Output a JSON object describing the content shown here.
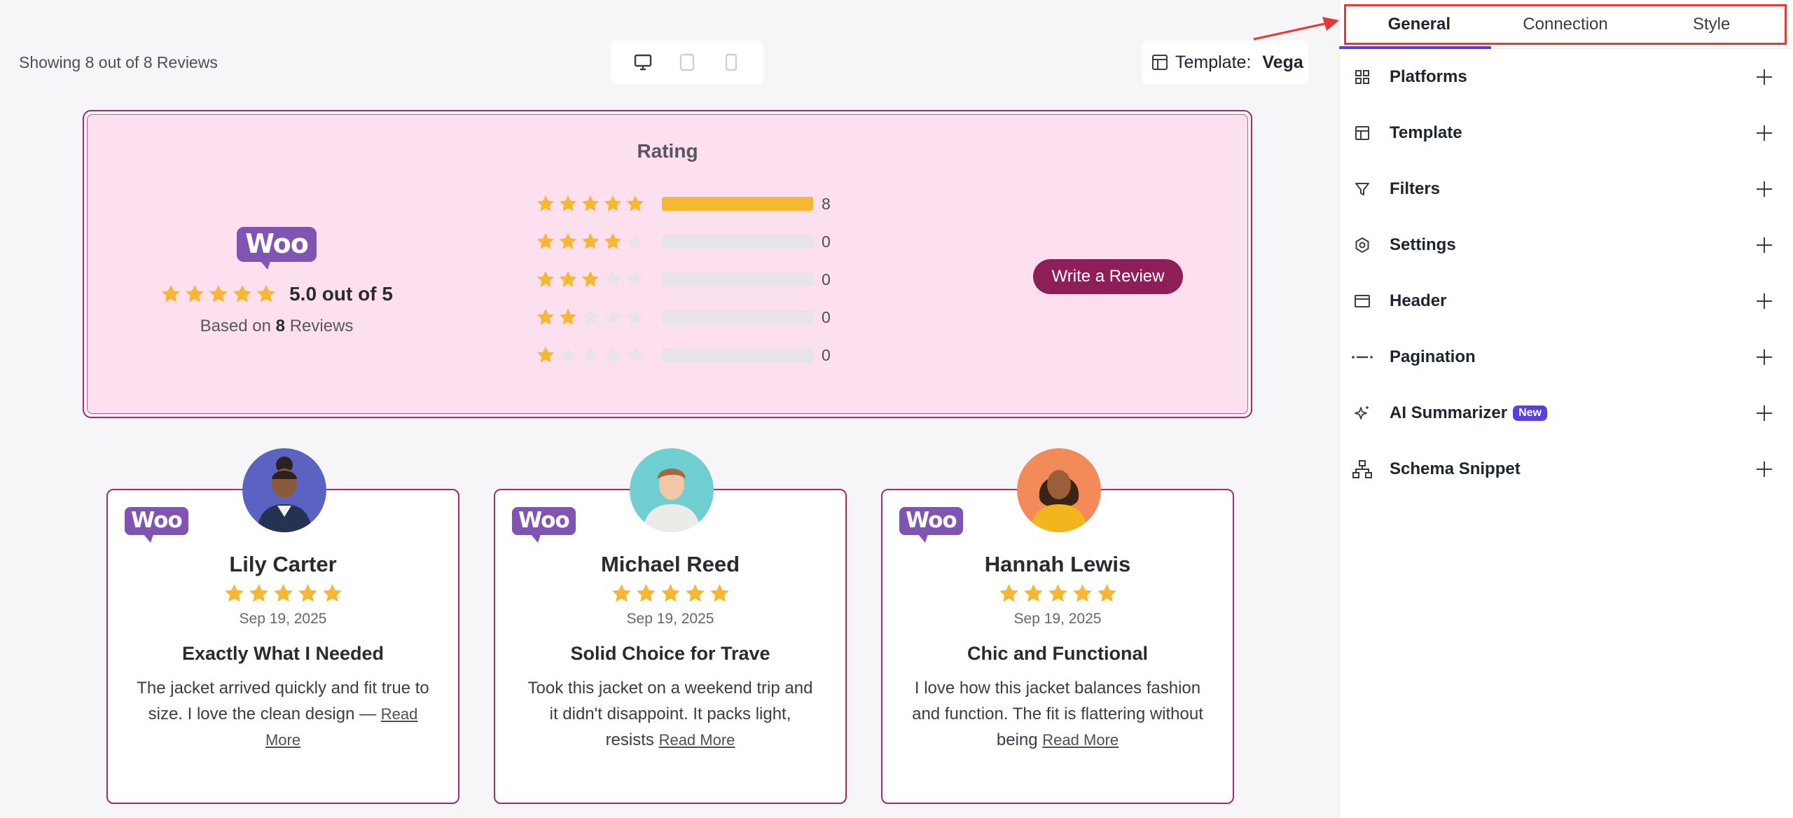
{
  "preview": {
    "showing_text": "Showing 8 out of 8 Reviews",
    "template_label": "Template:",
    "template_value": "Vega"
  },
  "rating": {
    "title": "Rating",
    "logo_text": "Woo",
    "score_text": "5.0 out of 5",
    "based_prefix": "Based on",
    "based_count": "8",
    "based_suffix": "Reviews",
    "distribution": [
      {
        "stars": 5,
        "count": "8",
        "fraction": 1.0
      },
      {
        "stars": 4,
        "count": "0",
        "fraction": 0.0
      },
      {
        "stars": 3,
        "count": "0",
        "fraction": 0.0
      },
      {
        "stars": 2,
        "count": "0",
        "fraction": 0.0
      },
      {
        "stars": 1,
        "count": "0",
        "fraction": 0.0
      }
    ],
    "write_review_label": "Write a Review"
  },
  "reviews": [
    {
      "name": "Lily Carter",
      "stars": 5,
      "date": "Sep 19, 2025",
      "title": "Exactly What I Needed",
      "body": "The jacket arrived quickly and fit true to size. I love the clean design —",
      "read_more": "Read More",
      "logo_text": "Woo",
      "avatar_bg": "#5b63c2"
    },
    {
      "name": "Michael Reed",
      "stars": 5,
      "date": "Sep 19, 2025",
      "title": "Solid Choice for Trave",
      "body": "Took this jacket on a weekend trip and it didn't disappoint. It packs light, resists",
      "read_more": "Read More",
      "logo_text": "Woo",
      "avatar_bg": "#6fcfd0"
    },
    {
      "name": "Hannah Lewis",
      "stars": 5,
      "date": "Sep 19, 2025",
      "title": "Chic and Functional",
      "body": "I love how this jacket balances fashion and function. The fit is flattering without being",
      "read_more": "Read More",
      "logo_text": "Woo",
      "avatar_bg": "#f28a5a"
    }
  ],
  "panel": {
    "tabs": [
      {
        "label": "General",
        "active": true
      },
      {
        "label": "Connection",
        "active": false
      },
      {
        "label": "Style",
        "active": false
      }
    ],
    "sections": [
      {
        "label": "Platforms",
        "icon": "grid-icon"
      },
      {
        "label": "Template",
        "icon": "layout-icon"
      },
      {
        "label": "Filters",
        "icon": "filter-icon"
      },
      {
        "label": "Settings",
        "icon": "gear-icon"
      },
      {
        "label": "Header",
        "icon": "header-icon"
      },
      {
        "label": "Pagination",
        "icon": "pagination-icon"
      },
      {
        "label": "AI Summarizer",
        "icon": "sparkle-icon",
        "badge": "New"
      },
      {
        "label": "Schema Snippet",
        "icon": "sitemap-icon"
      }
    ]
  },
  "colors": {
    "accent": "#5b3ee0",
    "brand": "#8e1e57",
    "star": "#f7b733",
    "star_empty": "#e6e4ea",
    "highlight": "#e53935",
    "woo": "#7f54b3"
  }
}
